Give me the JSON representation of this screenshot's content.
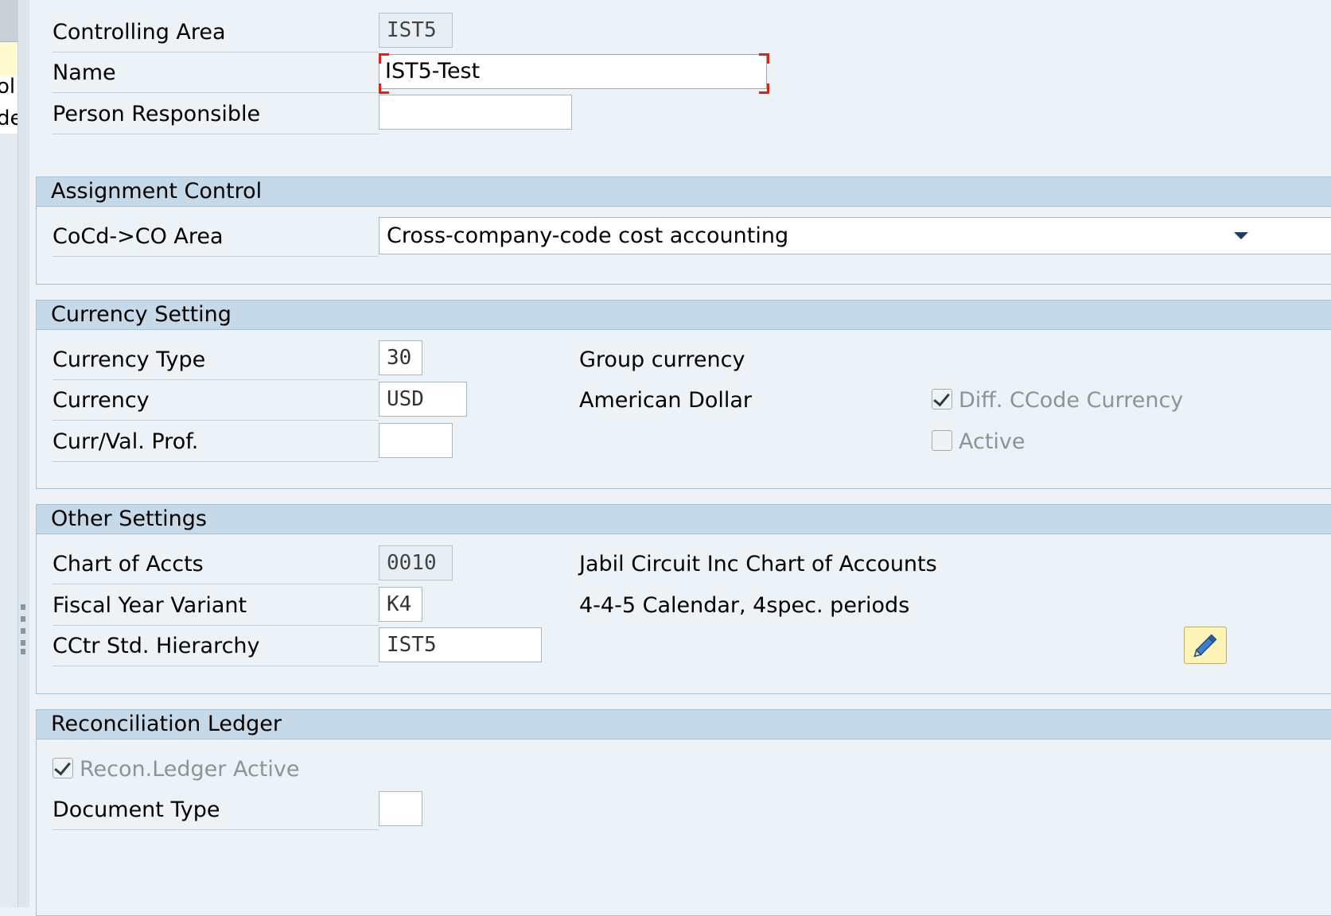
{
  "left_panel": {
    "line1": "ol",
    "line2": "de"
  },
  "header": {
    "controlling_area": {
      "label": "Controlling Area",
      "value": "IST5"
    },
    "name": {
      "label": "Name",
      "value": "IST5-Test"
    },
    "person_responsible": {
      "label": "Person Responsible",
      "value": ""
    }
  },
  "assignment_control": {
    "title": "Assignment Control",
    "cocd_co_area": {
      "label": "CoCd->CO Area",
      "value": "Cross-company-code cost accounting"
    }
  },
  "currency_setting": {
    "title": "Currency Setting",
    "currency_type": {
      "label": "Currency Type",
      "value": "30",
      "description": "Group currency"
    },
    "currency": {
      "label": "Currency",
      "value": "USD",
      "description": "American Dollar"
    },
    "curr_val_prof": {
      "label": "Curr/Val. Prof.",
      "value": ""
    },
    "diff_ccode_currency": {
      "label": "Diff. CCode Currency",
      "checked": true
    },
    "active": {
      "label": "Active",
      "checked": false
    }
  },
  "other_settings": {
    "title": "Other Settings",
    "chart_of_accts": {
      "label": "Chart of Accts",
      "value": "0010",
      "description": "Jabil Circuit Inc Chart of Accounts"
    },
    "fiscal_year_variant": {
      "label": "Fiscal Year Variant",
      "value": "K4",
      "description": "4-4-5 Calendar, 4spec. periods"
    },
    "cctr_std_hierarchy": {
      "label": "CCtr Std. Hierarchy",
      "value": "IST5"
    },
    "edit_button_icon": "pencil-icon"
  },
  "reconciliation_ledger": {
    "title": "Reconciliation Ledger",
    "recon_ledger_active": {
      "label": "Recon.Ledger Active",
      "checked": true
    },
    "document_type": {
      "label": "Document Type",
      "value": ""
    }
  },
  "colors": {
    "background": "#ecf2f6",
    "section_header": "#c6d9e8",
    "focus_corner": "#d0271e",
    "edit_button": "#fdf3b7"
  }
}
